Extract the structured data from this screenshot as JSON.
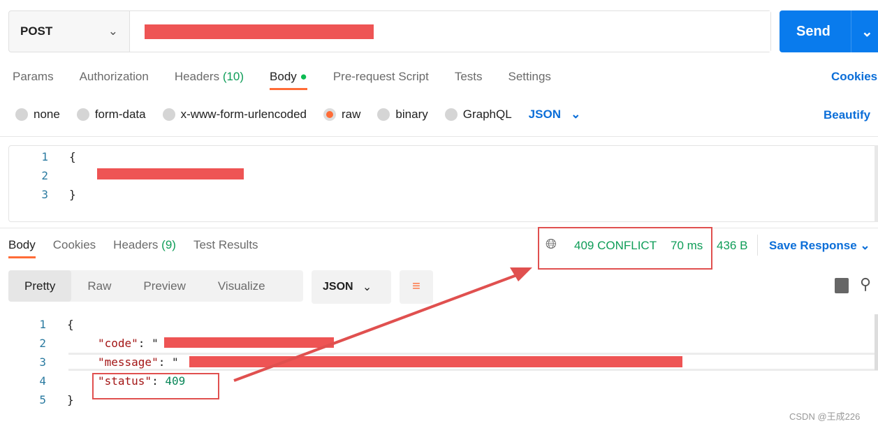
{
  "request": {
    "method": "POST",
    "send_label": "Send"
  },
  "req_tabs": [
    {
      "label": "Params"
    },
    {
      "label": "Authorization"
    },
    {
      "label": "Headers",
      "count": "(10)"
    },
    {
      "label": "Body"
    },
    {
      "label": "Pre-request Script"
    },
    {
      "label": "Tests"
    },
    {
      "label": "Settings"
    }
  ],
  "cookies_link": "Cookies",
  "body_types": [
    "none",
    "form-data",
    "x-www-form-urlencoded",
    "raw",
    "binary",
    "GraphQL"
  ],
  "body_format": "JSON",
  "beautify": "Beautify",
  "request_body": {
    "lines": [
      "1",
      "2",
      "3"
    ],
    "open": "{",
    "close": "}"
  },
  "resp_tabs": [
    {
      "label": "Body"
    },
    {
      "label": "Cookies"
    },
    {
      "label": "Headers",
      "count": "(9)"
    },
    {
      "label": "Test Results"
    }
  ],
  "status": {
    "code": "409 CONFLICT",
    "time": "70 ms",
    "size": "436 B",
    "save": "Save Response"
  },
  "view_modes": [
    "Pretty",
    "Raw",
    "Preview",
    "Visualize"
  ],
  "resp_format": "JSON",
  "response": {
    "lines": [
      "1",
      "2",
      "3",
      "4",
      "5"
    ],
    "open": "{",
    "close": "}",
    "code_key": "\"code\"",
    "message_key": "\"message\"",
    "status_key": "\"status\"",
    "status_value": "409"
  },
  "watermark": "CSDN @王成226",
  "colors": {
    "accent": "#ff6c37",
    "send": "#097bed",
    "success": "#0f9d58",
    "annotation": "#e0504f"
  }
}
